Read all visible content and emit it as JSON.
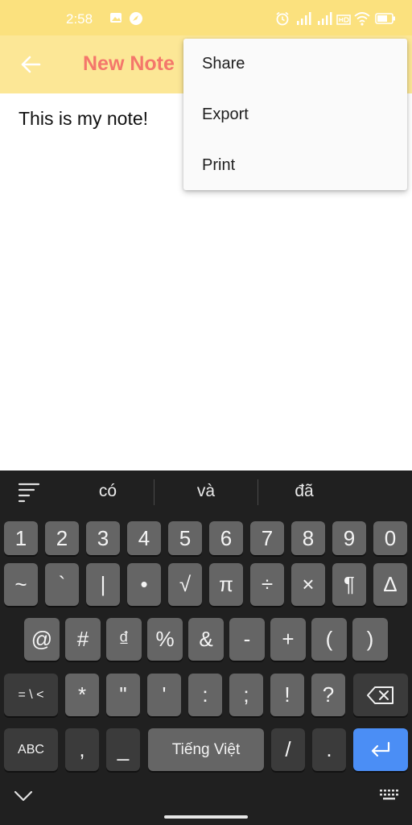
{
  "status_bar": {
    "time": "2:58",
    "icons": [
      "image-icon",
      "compass-icon",
      "alarm-icon",
      "signal-icon",
      "signal-icon",
      "hd-icon",
      "wifi-icon",
      "battery-icon"
    ]
  },
  "app_bar": {
    "back_icon": "arrow-left-icon",
    "title": "New Note"
  },
  "note": {
    "content": "This is my note!"
  },
  "overflow_menu": {
    "items": [
      "Share",
      "Export",
      "Print"
    ]
  },
  "keyboard": {
    "suggestions": [
      "có",
      "và",
      "đã"
    ],
    "row_numbers": [
      "1",
      "2",
      "3",
      "4",
      "5",
      "6",
      "7",
      "8",
      "9",
      "0"
    ],
    "row_symbols": [
      "~",
      "`",
      "|",
      "•",
      "√",
      "π",
      "÷",
      "×",
      "¶",
      "∆"
    ],
    "row_three": [
      "@",
      "#",
      "₫",
      "%",
      "&",
      "-",
      "+",
      "(",
      ")"
    ],
    "row_four": [
      "= \\ <",
      "*",
      "\"",
      "'",
      ":",
      ";",
      "!",
      "?"
    ],
    "row_five": {
      "abc": "ABC",
      "comma": ",",
      "underscore": "_",
      "space": "Tiếng Việt",
      "slash": "/",
      "period": "."
    },
    "colors": {
      "enter": "#4b8ef5",
      "background": "#202020",
      "key": "#656565"
    }
  }
}
